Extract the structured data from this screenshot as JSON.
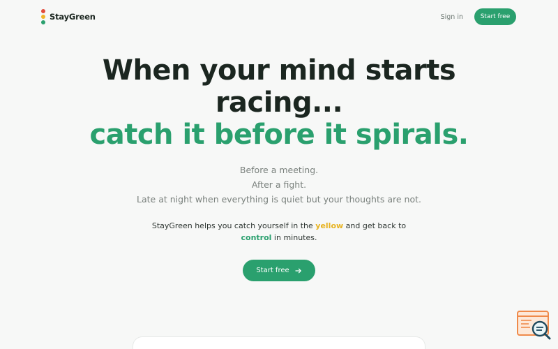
{
  "brand": {
    "name": "StayGreen",
    "colors": [
      "#e24b3b",
      "#f0b429",
      "#2aa06e"
    ]
  },
  "nav": {
    "signin": "Sign in",
    "start_free": "Start free"
  },
  "hero": {
    "line1": "When your mind starts",
    "line2": "racing...",
    "line3": "catch it before it spirals."
  },
  "sub": {
    "line1": "Before a meeting.",
    "line2": "After a fight.",
    "line3": "Late at night when everything is quiet but your thoughts are not."
  },
  "desc": {
    "before": "StayGreen helps you catch yourself in the ",
    "yellow": "yellow",
    "middle": " and get back to",
    "green": "control",
    "after": " in minutes."
  },
  "cta": {
    "label": "Start free",
    "icon": "arrow-right-icon"
  },
  "widget": {
    "icon": "search-chat-icon"
  },
  "colors": {
    "accent": "#2aa06e",
    "highlight_yellow": "#e7b321",
    "text": "#1b2620",
    "muted": "#7a817d"
  }
}
